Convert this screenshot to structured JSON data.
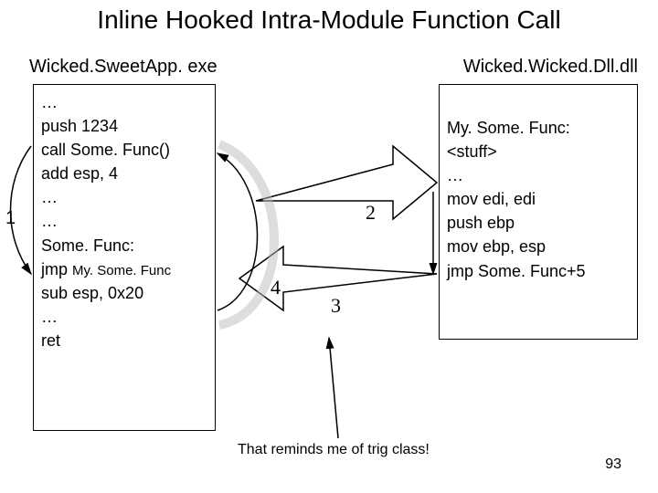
{
  "title": "Inline Hooked Intra-Module Function Call",
  "left_label": "Wicked.SweetApp. exe",
  "right_label": "Wicked.Wicked.Dll.dll",
  "left_code": {
    "l0": "…",
    "l1": "push 1234",
    "l2": "call Some. Func()",
    "l3": "add esp, 4",
    "l4": "…",
    "l5": "…",
    "l6": "Some. Func:",
    "l7a": "jmp ",
    "l7b": "My. Some. Func",
    "l8": "sub esp, 0x20",
    "l9": "…",
    "l10": "ret"
  },
  "right_code": {
    "r0": "My. Some. Func:",
    "r1": "<stuff>",
    "r2": "…",
    "r3": "mov edi, edi",
    "r4": "push ebp",
    "r5": "mov ebp, esp",
    "r6": "jmp Some. Func+5"
  },
  "step1": "1",
  "step2": "2",
  "step3": "3",
  "step4": "4",
  "caption": "That reminds me of trig class!",
  "page": "93"
}
